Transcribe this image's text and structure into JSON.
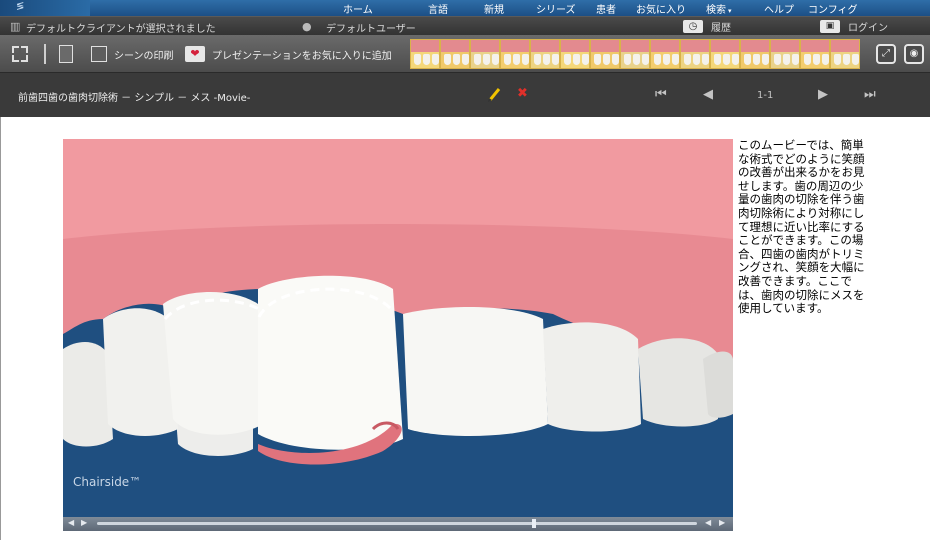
{
  "nav": {
    "items": [
      {
        "label": "ホーム"
      },
      {
        "label": "言語"
      },
      {
        "label": "新規"
      },
      {
        "label": "シリーズ"
      },
      {
        "label": "患者"
      },
      {
        "label": "お気に入り"
      },
      {
        "label": "検索",
        "caret": "▾"
      },
      {
        "label": "ヘルプ"
      },
      {
        "label": "コンフィグ"
      }
    ]
  },
  "status": {
    "client": "デフォルトクライアントが選択されました",
    "user": "デフォルトユーザー",
    "history": "履歴",
    "login": "ログイン"
  },
  "toolbar": {
    "print_label": "シーンの印刷",
    "favorite_label": "プレゼンテーションをお気に入りに追加",
    "thumbnail_count": 15
  },
  "title": {
    "text": "前歯四歯の歯肉切除術 － シンプル － メス -Movie-",
    "page": "1-1"
  },
  "video": {
    "watermark": "Chairside",
    "trademark": "™",
    "progress": 0.73
  },
  "description": "このムービーでは、簡単な術式でどのように笑顔の改善が出来るかをお見せします。歯の周辺の少量の歯肉の切除を伴う歯肉切除術により対称にして理想に近い比率にすることができます。この場合、四歯の歯肉がトリミングされ、笑顔を大幅に改善できます。ここでは、歯肉の切除にメスを使用しています。",
  "colors": {
    "gum": "#e88a92",
    "background": "#1f4f80",
    "accent": "#e0302a"
  }
}
